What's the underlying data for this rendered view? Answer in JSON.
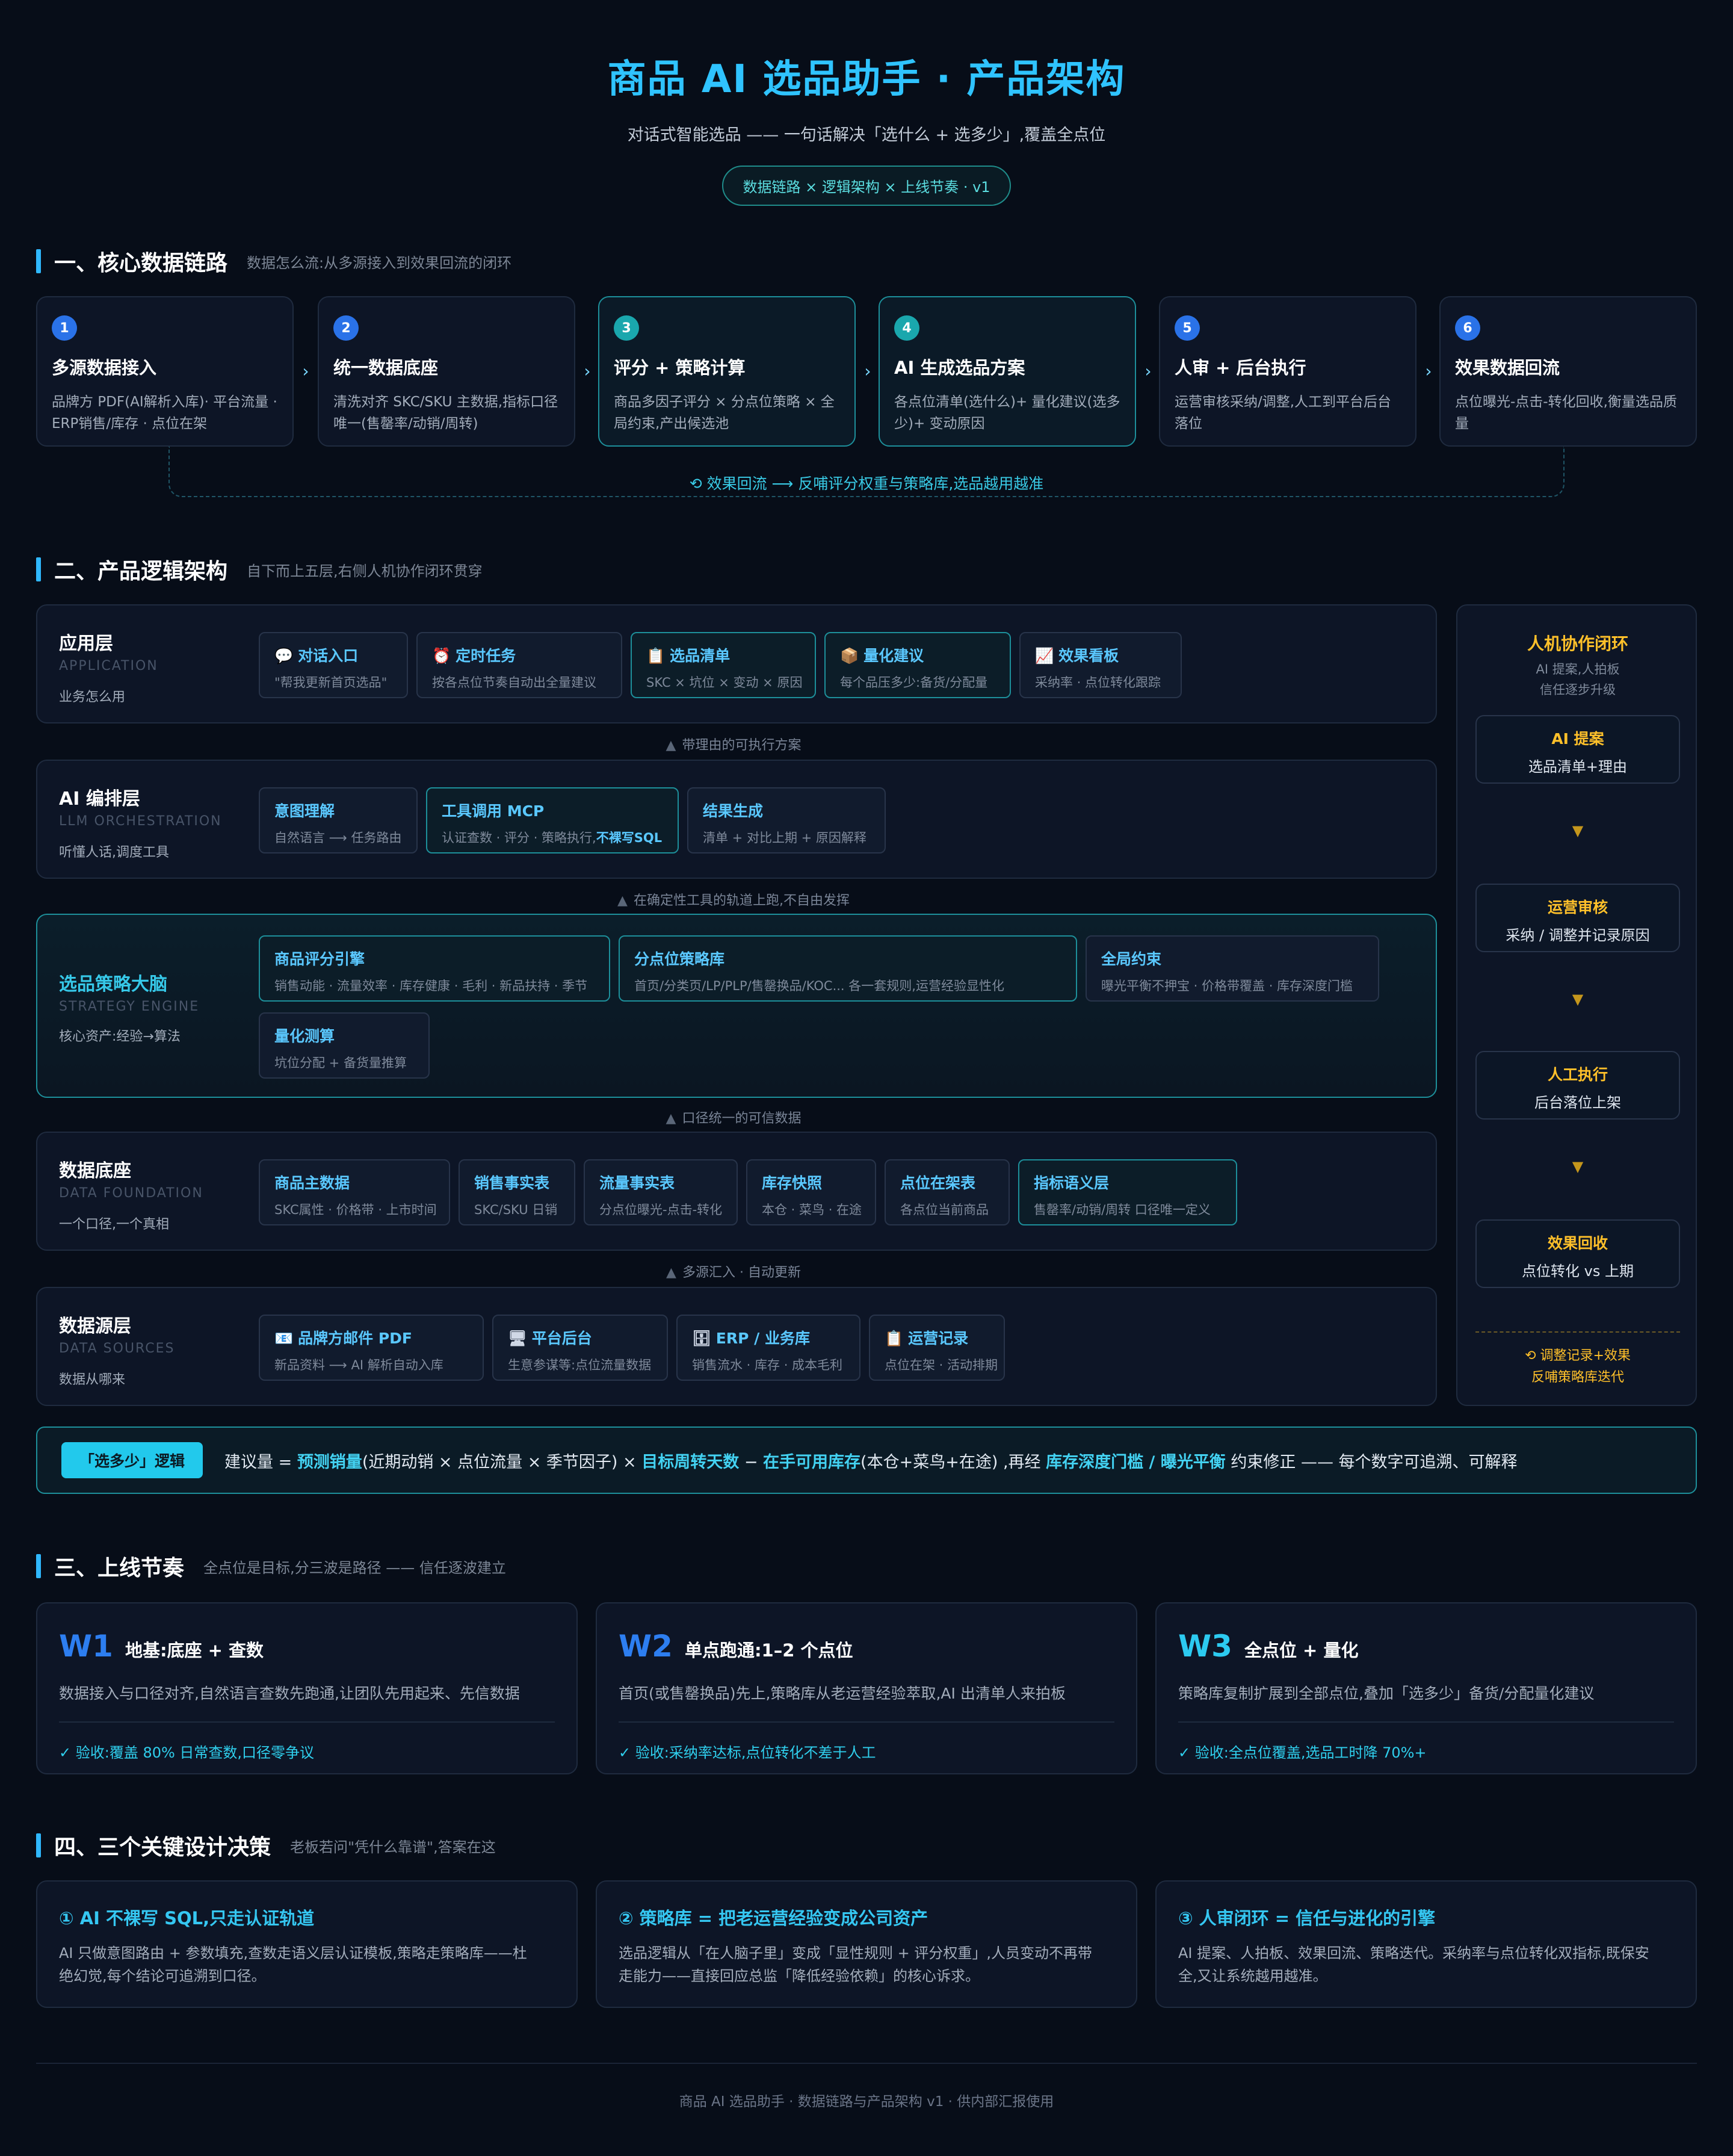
{
  "header": {
    "title": "商品 AI 选品助手 · 产品架构",
    "subtitle": "对话式智能选品 —— 一句话解决「选什么 + 选多少」,覆盖全点位",
    "pill": "数据链路 × 逻辑架构 × 上线节奏 · v1"
  },
  "s1": {
    "title": "一、核心数据链路",
    "sub": "数据怎么流:从多源接入到效果回流的闭环",
    "steps": [
      {
        "n": "1",
        "t": "多源数据接入",
        "d": "品牌方 PDF(AI解析入库)· 平台流量 · ERP销售/库存 · 点位在架"
      },
      {
        "n": "2",
        "t": "统一数据底座",
        "d": "清洗对齐 SKC/SKU 主数据,指标口径唯一(售罄率/动销/周转)"
      },
      {
        "n": "3",
        "t": "评分 + 策略计算",
        "d": "商品多因子评分 × 分点位策略 × 全局约束,产出候选池"
      },
      {
        "n": "4",
        "t": "AI 生成选品方案",
        "d": "各点位清单(选什么)+ 量化建议(选多少)+ 变动原因"
      },
      {
        "n": "5",
        "t": "人审 + 后台执行",
        "d": "运营审核采纳/调整,人工到平台后台落位"
      },
      {
        "n": "6",
        "t": "效果数据回流",
        "d": "点位曝光-点击-转化回收,衡量选品质量"
      }
    ],
    "loop": "⟲ 效果回流 ⟶ 反哺评分权重与策略库,选品越用越准"
  },
  "s2": {
    "title": "二、产品逻辑架构",
    "sub": "自下而上五层,右侧人机协作闭环贯穿",
    "app": {
      "name": "应用层",
      "en": "APPLICATION",
      "sub": "业务怎么用",
      "cards": [
        {
          "t": "对话入口",
          "d": "\"帮我更新首页选品\""
        },
        {
          "t": "定时任务",
          "d": "按各点位节奏自动出全量建议"
        },
        {
          "t": "选品清单",
          "d": "SKC × 坑位 × 变动 × 原因"
        },
        {
          "t": "量化建议",
          "d": "每个品压多少:备货/分配量"
        },
        {
          "t": "效果看板",
          "d": "采纳率 · 点位转化跟踪"
        }
      ]
    },
    "c1": "带理由的可执行方案",
    "ai": {
      "name": "AI 编排层",
      "en": "LLM ORCHESTRATION",
      "sub": "听懂人话,调度工具",
      "cards": [
        {
          "t": "意图理解",
          "d": "自然语言 ⟶ 任务路由"
        },
        {
          "t": "工具调用 MCP",
          "d": "认证查数 · 评分 · 策略执行,",
          "d2": "不裸写SQL"
        },
        {
          "t": "结果生成",
          "d": "清单 + 对比上期 + 原因解释"
        }
      ]
    },
    "c2": "在确定性工具的轨道上跑,不自由发挥",
    "eng": {
      "name": "选品策略大脑",
      "en": "STRATEGY ENGINE",
      "sub": "核心资产:经验→算法",
      "cards": [
        {
          "t": "商品评分引擎",
          "d": "销售动能 · 流量效率 · 库存健康 · 毛利 · 新品扶持 · 季节"
        },
        {
          "t": "分点位策略库",
          "d": "首页/分类页/LP/PLP/售罄换品/KOC... 各一套规则,运营经验显性化"
        },
        {
          "t": "全局约束",
          "d": "曝光平衡不押宝 · 价格带覆盖 · 库存深度门槛"
        },
        {
          "t": "量化测算",
          "d": "坑位分配 + 备货量推算"
        }
      ]
    },
    "c3": "口径统一的可信数据",
    "data": {
      "name": "数据底座",
      "en": "DATA FOUNDATION",
      "sub": "一个口径,一个真相",
      "cards": [
        {
          "t": "商品主数据",
          "d": "SKC属性 · 价格带 · 上市时间"
        },
        {
          "t": "销售事实表",
          "d": "SKC/SKU 日销"
        },
        {
          "t": "流量事实表",
          "d": "分点位曝光-点击-转化"
        },
        {
          "t": "库存快照",
          "d": "本仓 · 菜鸟 · 在途"
        },
        {
          "t": "点位在架表",
          "d": "各点位当前商品"
        },
        {
          "t": "指标语义层",
          "d": "售罄率/动销/周转 口径唯一定义"
        }
      ]
    },
    "c4": "多源汇入 · 自动更新",
    "src": {
      "name": "数据源层",
      "en": "DATA SOURCES",
      "sub": "数据从哪来",
      "cards": [
        {
          "t": "品牌方邮件 PDF",
          "d": "新品资料 ⟶ AI 解析自动入库"
        },
        {
          "t": "平台后台",
          "d": "生意参谋等:点位流量数据"
        },
        {
          "t": "ERP / 业务库",
          "d": "销售流水 · 库存 · 成本毛利"
        },
        {
          "t": "运营记录",
          "d": "点位在架 · 活动排期"
        }
      ]
    },
    "side": {
      "title": "人机协作闭环",
      "l1": "AI 提案,人拍板",
      "l2": "信任逐步升级",
      "boxes": [
        {
          "a": "AI 提案",
          "b": "选品清单+理由"
        },
        {
          "a": "运营审核",
          "b": "采纳 / 调整并记录原因"
        },
        {
          "a": "人工执行",
          "b": "后台落位上架"
        },
        {
          "a": "效果回收",
          "b": "点位转化 vs 上期"
        }
      ],
      "f1": "⟲ 调整记录+效果",
      "f2": "反哺策略库迭代"
    },
    "formula": {
      "tag": "「选多少」逻辑",
      "p1": "建议量 = ",
      "b1": "预测销量",
      "p2": "(近期动销 × 点位流量 × 季节因子) × ",
      "b2": "目标周转天数",
      "p3": " − ",
      "b3": "在手可用库存",
      "p4": "(本仓+菜鸟+在途) ,再经 ",
      "b4": "库存深度门槛 / 曝光平衡",
      "p5": " 约束修正 —— 每个数字可追溯、可解释"
    }
  },
  "s3": {
    "title": "三、上线节奏",
    "sub": "全点位是目标,分三波是路径 —— 信任逐波建立",
    "waves": [
      {
        "k": "W1",
        "t": "地基:底座 + 查数",
        "d": "数据接入与口径对齐,自然语言查数先跑通,让团队先用起来、先信数据",
        "a": "✓ 验收:覆盖 80% 日常查数,口径零争议"
      },
      {
        "k": "W2",
        "t": "单点跑通:1–2 个点位",
        "d": "首页(或售罄换品)先上,策略库从老运营经验萃取,AI 出清单人来拍板",
        "a": "✓ 验收:采纳率达标,点位转化不差于人工"
      },
      {
        "k": "W3",
        "t": "全点位 + 量化",
        "d": "策略库复制扩展到全部点位,叠加「选多少」备货/分配量化建议",
        "a": "✓ 验收:全点位覆盖,选品工时降 70%+"
      }
    ]
  },
  "s4": {
    "title": "四、三个关键设计决策",
    "sub": "老板若问\"凭什么靠谱\",答案在这",
    "items": [
      {
        "t": "① AI 不裸写 SQL,只走认证轨道",
        "d1": "AI 只做意图路由 + 参数填充,查数走语义层认证模板,策略走策略库——杜",
        "d2": "绝幻觉,每个结论可追溯到口径。"
      },
      {
        "t": "② 策略库 = 把老运营经验变成公司资产",
        "d1": "选品逻辑从「在人脑子里」变成「显性规则 + 评分权重」,人员变动不再带",
        "d2": "走能力——直接回应总监「降低经验依赖」的核心诉求。"
      },
      {
        "t": "③ 人审闭环 = 信任与进化的引擎",
        "d1": "AI 提案、人拍板、效果回流、策略迭代。采纳率与点位转化双指标,既保安",
        "d2": "全,又让系统越用越准。"
      }
    ]
  },
  "footer": "商品 AI 选品助手 · 数据链路与产品架构 v1 · 供内部汇报使用"
}
